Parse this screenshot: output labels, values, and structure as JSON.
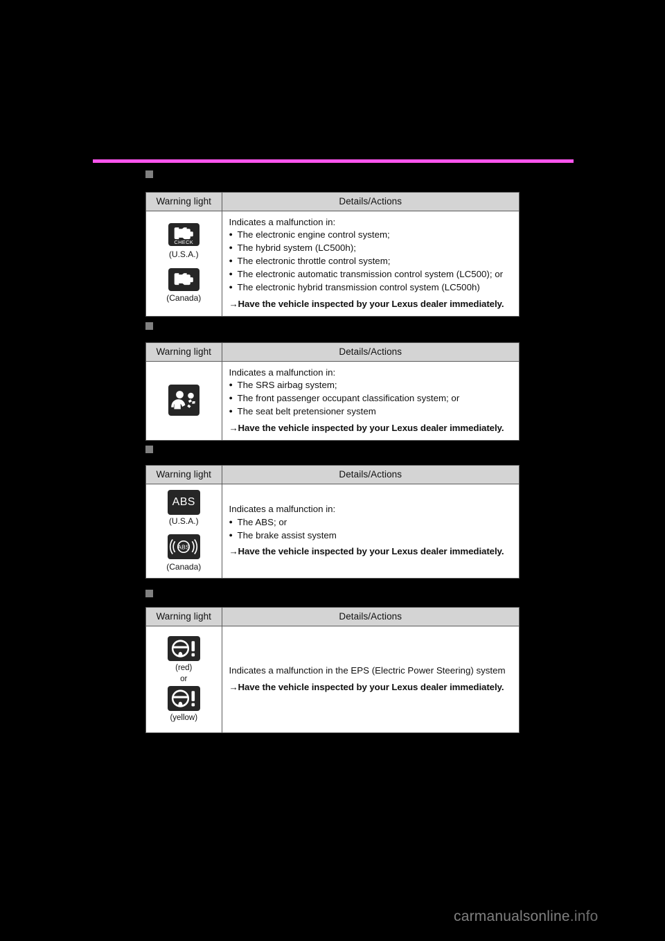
{
  "page": {
    "background_color": "#000000",
    "rule_color": "#ff55ee",
    "marker_color": "#808080",
    "header_bg_color": "#d4d4d4",
    "icon_tile_color": "#262626"
  },
  "columns": {
    "warning_light": "Warning light",
    "details_actions": "Details/Actions"
  },
  "sections": [
    {
      "id": "check-engine",
      "lights": [
        {
          "icon": "check-engine-icon",
          "glyph_label": "CHECK",
          "caption": "(U.S.A.)"
        },
        {
          "icon": "engine-icon",
          "glyph_label": "",
          "caption": "(Canada)"
        }
      ],
      "lead": "Indicates a malfunction in:",
      "bullets": [
        "The electronic engine control system;",
        "The hybrid system (LC500h);",
        "The electronic throttle control system;",
        "The electronic automatic transmission control system (LC500); or",
        "The electronic hybrid transmission control system (LC500h)"
      ],
      "action": "Have the vehicle inspected by your Lexus dealer immediately."
    },
    {
      "id": "srs-airbag",
      "lights": [
        {
          "icon": "srs-airbag-icon",
          "glyph_label": "",
          "caption": ""
        }
      ],
      "lead": "Indicates a malfunction in:",
      "bullets": [
        "The SRS airbag system;",
        "The front passenger occupant classification system; or",
        "The seat belt pretensioner system"
      ],
      "action": "Have the vehicle inspected by your Lexus dealer immediately."
    },
    {
      "id": "abs",
      "lights": [
        {
          "icon": "abs-text-icon",
          "glyph_label": "ABS",
          "caption": "(U.S.A.)"
        },
        {
          "icon": "abs-circle-icon",
          "glyph_label": "ABS",
          "caption": "(Canada)"
        }
      ],
      "lead": "Indicates a malfunction in:",
      "bullets": [
        "The ABS; or",
        "The brake assist system"
      ],
      "action": "Have the vehicle inspected by your Lexus dealer immediately."
    },
    {
      "id": "eps",
      "lights": [
        {
          "icon": "eps-steering-icon",
          "glyph_label": "",
          "caption": "(red)"
        },
        {
          "icon": "eps-steering-icon",
          "glyph_label": "",
          "caption": "(yellow)"
        }
      ],
      "separator": "or",
      "lead": "Indicates a malfunction in the EPS (Electric Power Steering) system",
      "bullets": [],
      "action": "Have the vehicle inspected by your Lexus dealer immediately."
    }
  ],
  "watermark": {
    "name": "carmanualsonline",
    "tld": ".info"
  }
}
